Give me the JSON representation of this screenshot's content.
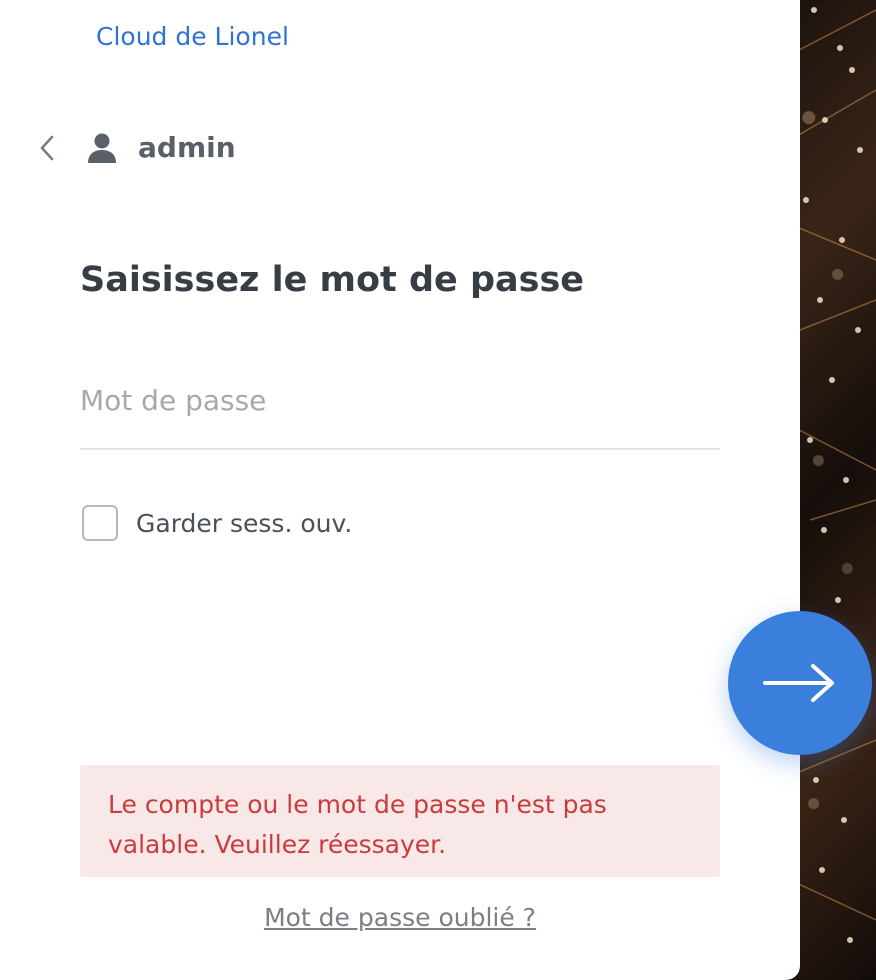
{
  "brand": {
    "name": "Cloud de Lionel"
  },
  "user": {
    "back_icon": "chevron-left-icon",
    "avatar_icon": "user-icon",
    "username": "admin"
  },
  "form": {
    "title": "Saisissez le mot de passe",
    "password_placeholder": "Mot de passe",
    "password_value": "",
    "keep_session_label": "Garder sess. ouv.",
    "keep_session_checked": false,
    "next_icon": "arrow-right-icon"
  },
  "error": {
    "line1": "Le compte ou le mot de passe n'est pas",
    "line2": "valable. Veuillez réessayer."
  },
  "links": {
    "forgot_password": "Mot de passe oublié ?"
  },
  "colors": {
    "accent": "#3a7fdc",
    "brand_link": "#2f73d6",
    "error_text": "#cc3b3b",
    "error_bg": "#f9e8e8"
  }
}
